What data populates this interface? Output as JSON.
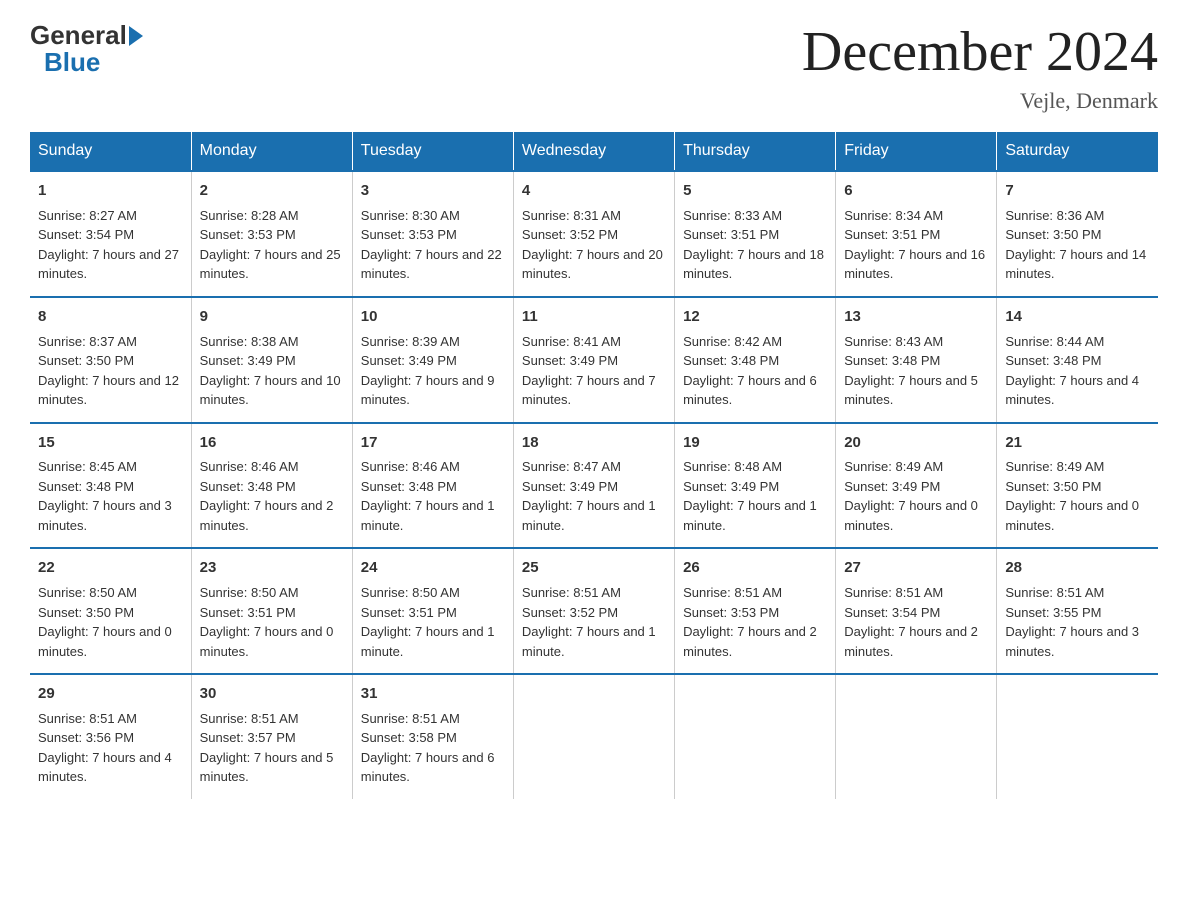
{
  "logo": {
    "general": "General",
    "blue": "Blue"
  },
  "header": {
    "title": "December 2024",
    "location": "Vejle, Denmark"
  },
  "days_of_week": [
    "Sunday",
    "Monday",
    "Tuesday",
    "Wednesday",
    "Thursday",
    "Friday",
    "Saturday"
  ],
  "weeks": [
    [
      {
        "day": "1",
        "sunrise": "8:27 AM",
        "sunset": "3:54 PM",
        "daylight": "7 hours and 27 minutes."
      },
      {
        "day": "2",
        "sunrise": "8:28 AM",
        "sunset": "3:53 PM",
        "daylight": "7 hours and 25 minutes."
      },
      {
        "day": "3",
        "sunrise": "8:30 AM",
        "sunset": "3:53 PM",
        "daylight": "7 hours and 22 minutes."
      },
      {
        "day": "4",
        "sunrise": "8:31 AM",
        "sunset": "3:52 PM",
        "daylight": "7 hours and 20 minutes."
      },
      {
        "day": "5",
        "sunrise": "8:33 AM",
        "sunset": "3:51 PM",
        "daylight": "7 hours and 18 minutes."
      },
      {
        "day": "6",
        "sunrise": "8:34 AM",
        "sunset": "3:51 PM",
        "daylight": "7 hours and 16 minutes."
      },
      {
        "day": "7",
        "sunrise": "8:36 AM",
        "sunset": "3:50 PM",
        "daylight": "7 hours and 14 minutes."
      }
    ],
    [
      {
        "day": "8",
        "sunrise": "8:37 AM",
        "sunset": "3:50 PM",
        "daylight": "7 hours and 12 minutes."
      },
      {
        "day": "9",
        "sunrise": "8:38 AM",
        "sunset": "3:49 PM",
        "daylight": "7 hours and 10 minutes."
      },
      {
        "day": "10",
        "sunrise": "8:39 AM",
        "sunset": "3:49 PM",
        "daylight": "7 hours and 9 minutes."
      },
      {
        "day": "11",
        "sunrise": "8:41 AM",
        "sunset": "3:49 PM",
        "daylight": "7 hours and 7 minutes."
      },
      {
        "day": "12",
        "sunrise": "8:42 AM",
        "sunset": "3:48 PM",
        "daylight": "7 hours and 6 minutes."
      },
      {
        "day": "13",
        "sunrise": "8:43 AM",
        "sunset": "3:48 PM",
        "daylight": "7 hours and 5 minutes."
      },
      {
        "day": "14",
        "sunrise": "8:44 AM",
        "sunset": "3:48 PM",
        "daylight": "7 hours and 4 minutes."
      }
    ],
    [
      {
        "day": "15",
        "sunrise": "8:45 AM",
        "sunset": "3:48 PM",
        "daylight": "7 hours and 3 minutes."
      },
      {
        "day": "16",
        "sunrise": "8:46 AM",
        "sunset": "3:48 PM",
        "daylight": "7 hours and 2 minutes."
      },
      {
        "day": "17",
        "sunrise": "8:46 AM",
        "sunset": "3:48 PM",
        "daylight": "7 hours and 1 minute."
      },
      {
        "day": "18",
        "sunrise": "8:47 AM",
        "sunset": "3:49 PM",
        "daylight": "7 hours and 1 minute."
      },
      {
        "day": "19",
        "sunrise": "8:48 AM",
        "sunset": "3:49 PM",
        "daylight": "7 hours and 1 minute."
      },
      {
        "day": "20",
        "sunrise": "8:49 AM",
        "sunset": "3:49 PM",
        "daylight": "7 hours and 0 minutes."
      },
      {
        "day": "21",
        "sunrise": "8:49 AM",
        "sunset": "3:50 PM",
        "daylight": "7 hours and 0 minutes."
      }
    ],
    [
      {
        "day": "22",
        "sunrise": "8:50 AM",
        "sunset": "3:50 PM",
        "daylight": "7 hours and 0 minutes."
      },
      {
        "day": "23",
        "sunrise": "8:50 AM",
        "sunset": "3:51 PM",
        "daylight": "7 hours and 0 minutes."
      },
      {
        "day": "24",
        "sunrise": "8:50 AM",
        "sunset": "3:51 PM",
        "daylight": "7 hours and 1 minute."
      },
      {
        "day": "25",
        "sunrise": "8:51 AM",
        "sunset": "3:52 PM",
        "daylight": "7 hours and 1 minute."
      },
      {
        "day": "26",
        "sunrise": "8:51 AM",
        "sunset": "3:53 PM",
        "daylight": "7 hours and 2 minutes."
      },
      {
        "day": "27",
        "sunrise": "8:51 AM",
        "sunset": "3:54 PM",
        "daylight": "7 hours and 2 minutes."
      },
      {
        "day": "28",
        "sunrise": "8:51 AM",
        "sunset": "3:55 PM",
        "daylight": "7 hours and 3 minutes."
      }
    ],
    [
      {
        "day": "29",
        "sunrise": "8:51 AM",
        "sunset": "3:56 PM",
        "daylight": "7 hours and 4 minutes."
      },
      {
        "day": "30",
        "sunrise": "8:51 AM",
        "sunset": "3:57 PM",
        "daylight": "7 hours and 5 minutes."
      },
      {
        "day": "31",
        "sunrise": "8:51 AM",
        "sunset": "3:58 PM",
        "daylight": "7 hours and 6 minutes."
      },
      null,
      null,
      null,
      null
    ]
  ],
  "labels": {
    "sunrise": "Sunrise:",
    "sunset": "Sunset:",
    "daylight": "Daylight:"
  }
}
